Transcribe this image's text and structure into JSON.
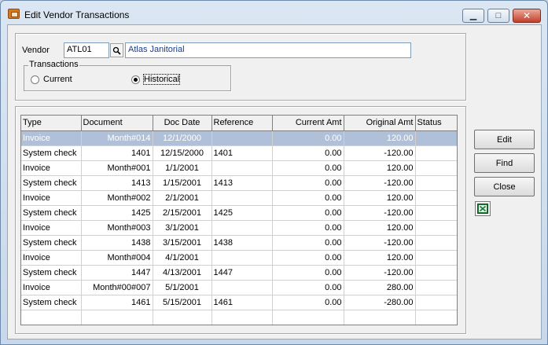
{
  "window": {
    "title": "Edit Vendor Transactions",
    "minimize_glyph": "▁",
    "maximize_glyph": "□",
    "close_glyph": "✕"
  },
  "vendor": {
    "label": "Vendor",
    "id": "ATL01",
    "name": "Atlas Janitorial",
    "lookup_icon": "magnifier-icon"
  },
  "transactions": {
    "group_label": "Transactions",
    "options": [
      {
        "label": "Current",
        "selected": false
      },
      {
        "label": "Historical",
        "selected": true
      }
    ]
  },
  "grid": {
    "columns": [
      "Type",
      "Document",
      "Doc Date",
      "Reference",
      "Current Amt",
      "Original Amt",
      "Status"
    ],
    "rows": [
      {
        "type": "Invoice",
        "document": "Month#014",
        "doc_date": "12/1/2000",
        "reference": "",
        "current_amt": "0.00",
        "original_amt": "120.00",
        "status": ""
      },
      {
        "type": "System check",
        "document": "1401",
        "doc_date": "12/15/2000",
        "reference": "1401",
        "current_amt": "0.00",
        "original_amt": "-120.00",
        "status": ""
      },
      {
        "type": "Invoice",
        "document": "Month#001",
        "doc_date": "1/1/2001",
        "reference": "",
        "current_amt": "0.00",
        "original_amt": "120.00",
        "status": ""
      },
      {
        "type": "System check",
        "document": "1413",
        "doc_date": "1/15/2001",
        "reference": "1413",
        "current_amt": "0.00",
        "original_amt": "-120.00",
        "status": ""
      },
      {
        "type": "Invoice",
        "document": "Month#002",
        "doc_date": "2/1/2001",
        "reference": "",
        "current_amt": "0.00",
        "original_amt": "120.00",
        "status": ""
      },
      {
        "type": "System check",
        "document": "1425",
        "doc_date": "2/15/2001",
        "reference": "1425",
        "current_amt": "0.00",
        "original_amt": "-120.00",
        "status": ""
      },
      {
        "type": "Invoice",
        "document": "Month#003",
        "doc_date": "3/1/2001",
        "reference": "",
        "current_amt": "0.00",
        "original_amt": "120.00",
        "status": ""
      },
      {
        "type": "System check",
        "document": "1438",
        "doc_date": "3/15/2001",
        "reference": "1438",
        "current_amt": "0.00",
        "original_amt": "-120.00",
        "status": ""
      },
      {
        "type": "Invoice",
        "document": "Month#004",
        "doc_date": "4/1/2001",
        "reference": "",
        "current_amt": "0.00",
        "original_amt": "120.00",
        "status": ""
      },
      {
        "type": "System check",
        "document": "1447",
        "doc_date": "4/13/2001",
        "reference": "1447",
        "current_amt": "0.00",
        "original_amt": "-120.00",
        "status": ""
      },
      {
        "type": "Invoice",
        "document": "Month#00#007",
        "doc_date": "5/1/2001",
        "reference": "",
        "current_amt": "0.00",
        "original_amt": "280.00",
        "status": ""
      },
      {
        "type": "System check",
        "document": "1461",
        "doc_date": "5/15/2001",
        "reference": "1461",
        "current_amt": "0.00",
        "original_amt": "-280.00",
        "status": ""
      }
    ]
  },
  "buttons": {
    "edit": "Edit",
    "find": "Find",
    "close": "Close",
    "export_icon": "excel-icon"
  },
  "colors": {
    "selected_row": "#b0c0d8",
    "vendor_name_text": "#1a3a8a"
  }
}
